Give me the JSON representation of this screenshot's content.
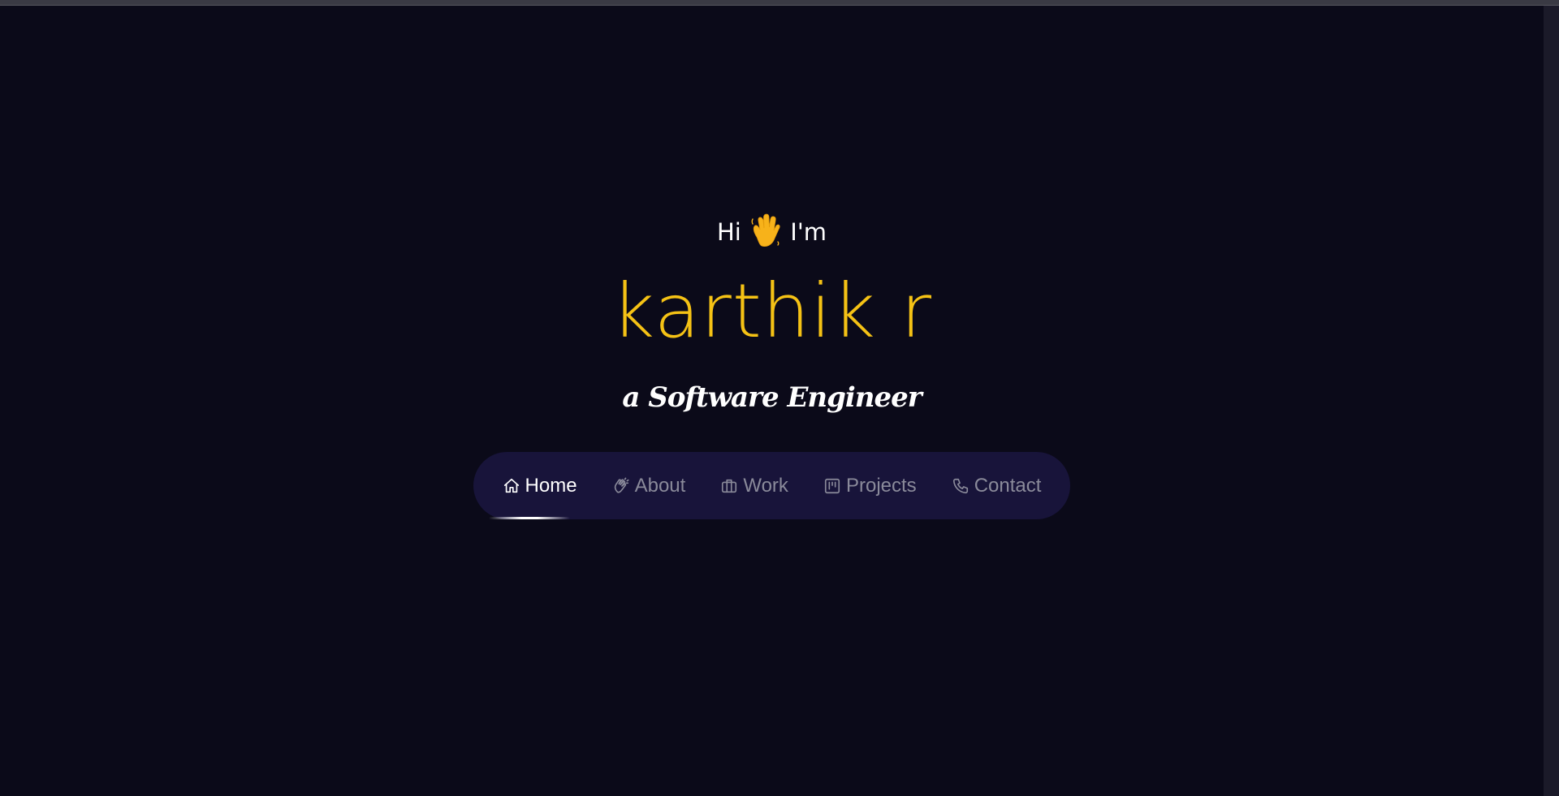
{
  "hero": {
    "greeting_prefix": "Hi",
    "wave_icon": "waving-hand-icon",
    "greeting_suffix": "I'm",
    "name": "karthik r",
    "role": "a Software Engineer"
  },
  "nav": {
    "items": [
      {
        "label": "Home",
        "icon": "home-icon",
        "active": true
      },
      {
        "label": "About",
        "icon": "clap-icon",
        "active": false
      },
      {
        "label": "Work",
        "icon": "briefcase-icon",
        "active": false
      },
      {
        "label": "Projects",
        "icon": "kanban-icon",
        "active": false
      },
      {
        "label": "Contact",
        "icon": "phone-icon",
        "active": false
      }
    ]
  },
  "colors": {
    "background": "#0b0a19",
    "accent": "#f5c215",
    "nav_background": "#18143a",
    "nav_inactive": "#8a8a9a",
    "nav_active": "#ffffff"
  }
}
